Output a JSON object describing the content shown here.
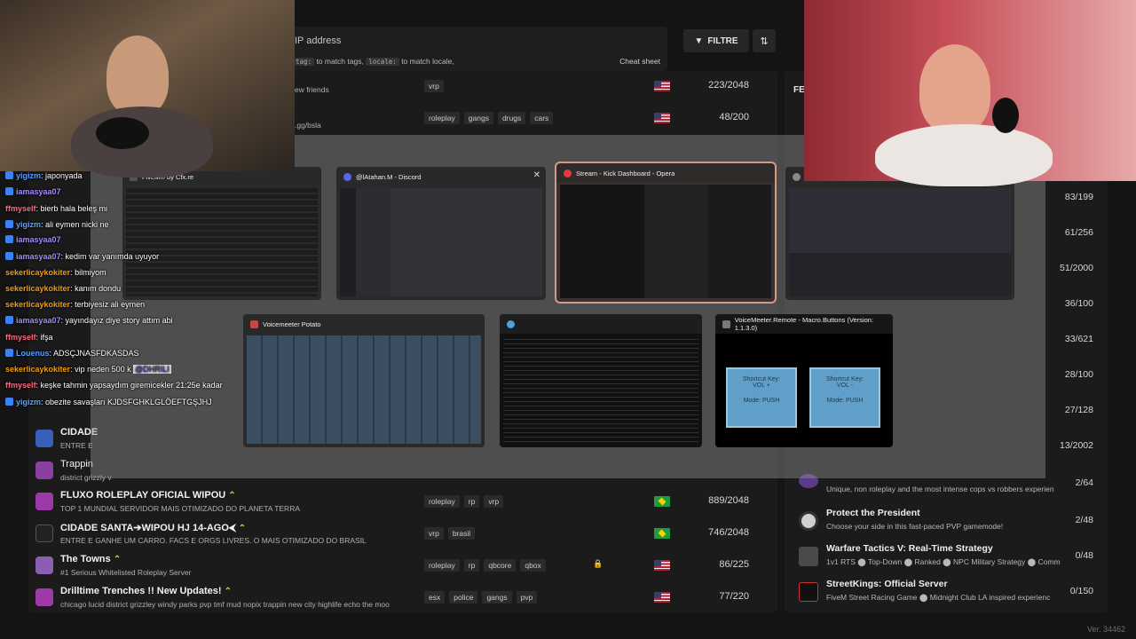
{
  "search": {
    "placeholder": "IP address",
    "hint_tag_code": "tag:",
    "hint_tag_text": "to match tags,",
    "hint_locale_code": "locale:",
    "hint_locale_text": "to match locale,",
    "cheat_sheet": "Cheat sheet"
  },
  "toolbar": {
    "filter_label": "FILTRE",
    "filter_icon": "funnel-icon",
    "sort_icon": "sort-icon"
  },
  "servers": [
    {
      "name": "",
      "desc": "ew friends",
      "tags": [
        "vrp"
      ],
      "flag": "us",
      "count": "223/2048"
    },
    {
      "name": "",
      "desc": ".gg/bsla",
      "tags": [
        "roleplay",
        "gangs",
        "drugs",
        "cars"
      ],
      "flag": "us",
      "count": "48/200"
    },
    {
      "name": "CIDADE",
      "desc": "ENTRE E",
      "tags": [],
      "flag": "",
      "count": ""
    },
    {
      "name": "Trappin",
      "desc": "district grizzly v",
      "tags": [],
      "flag": "",
      "count": ""
    },
    {
      "name": "FLUXO ROLEPLAY OFICIAL WIPOU",
      "desc": "TOP 1 MUNDIAL SERVIDOR MAIS OTIMIZADO DO PLANETA TERRA",
      "tags": [
        "roleplay",
        "rp",
        "vrp"
      ],
      "flag": "br",
      "count": "889/2048"
    },
    {
      "name": "CIDADE SANTA➔WIPOU HJ 14-AGO⮜",
      "desc": "ENTRE E GANHE UM CARRO. FACS E ORGS LIVRES. O MAIS OTIMIZADO DO BRASIL",
      "tags": [
        "vrp",
        "brasil"
      ],
      "flag": "br",
      "count": "746/2048"
    },
    {
      "name": "The Towns",
      "desc": "#1 Serious Whitelisted Roleplay Server",
      "tags": [
        "roleplay",
        "rp",
        "qbcore",
        "qbox"
      ],
      "flag": "us",
      "count": "86/225"
    },
    {
      "name": "Drilltime Trenches !! New Updates!",
      "desc": "chicago lucid district grizzley windy parks pvp tmf mud nopix trappin new city highlife echo the moo",
      "tags": [
        "esx",
        "police",
        "gangs",
        "pvp"
      ],
      "flag": "us",
      "count": "77/220"
    }
  ],
  "right_panel": {
    "heading": "FE",
    "side_counts": [
      "83/199",
      "61/256",
      "51/2000",
      "36/100",
      "33/621",
      "28/100",
      "27/128",
      "13/2002"
    ],
    "items": [
      {
        "name": "",
        "desc": "Unique, non roleplay and the most intense cops vs robbers experien",
        "count": "2/64"
      },
      {
        "name": "Protect the President",
        "desc": "Choose your side in this fast-paced PVP gamemode!",
        "count": "2/48"
      },
      {
        "name": "Warfare Tactics V: Real-Time Strategy",
        "desc": "1v1 RTS ⬤ Top-Down ⬤ Ranked ⬤ NPC Military Strategy ⬤ Comm",
        "count": "0/48"
      },
      {
        "name": "StreetKings: Official Server",
        "desc": "FiveM Street Racing Game ⬤ Midnight Club LA inspired experienc",
        "count": "0/150"
      }
    ]
  },
  "version": "Ver. 34462",
  "task_switcher": {
    "windows": [
      {
        "title": "FiveM® by Cfx.re"
      },
      {
        "title": "@lAtahan.M - Discord"
      },
      {
        "title": "Stream - Kick Dashboard - Opera"
      },
      {
        "title": ""
      },
      {
        "title": "Voicemeeter Potato"
      },
      {
        "title": ""
      },
      {
        "title": "VoiceMeeter.Remote - Macro.Buttons (Version: 1.1.3.0)"
      }
    ],
    "macro_buttons": [
      {
        "line1": "Shortcut Key:",
        "line2": "VOL +",
        "mode": "Mode: PUSH"
      },
      {
        "line1": "Shortcut Key:",
        "line2": "VOL -",
        "mode": "Mode: PUSH"
      }
    ]
  },
  "chat": [
    {
      "user": "yigizm",
      "text": ": japonyada",
      "color": "#5aa0ff",
      "badge": true
    },
    {
      "user": "iamasyaa07",
      "text": "",
      "color": "#a78bfa",
      "badge": true
    },
    {
      "user": "ffmyself",
      "text": ": bierb hala beleş mi",
      "color": "#ff6b81",
      "badge": false
    },
    {
      "user": "yigizm",
      "text": ": ali eymen nicki ne",
      "color": "#5aa0ff",
      "badge": true
    },
    {
      "user": "iamasyaa07",
      "text": "",
      "color": "#a78bfa",
      "badge": true
    },
    {
      "user": "iamasyaa07",
      "text": ": kedim var yanımda uyuyor",
      "color": "#a78bfa",
      "badge": true
    },
    {
      "user": "sekerlicaykokiter",
      "text": ": bilmiyom",
      "color": "#f59e0b",
      "badge": false
    },
    {
      "user": "sekerlicaykokiter",
      "text": ": kanım dondu",
      "color": "#f59e0b",
      "badge": false
    },
    {
      "user": "sekerlicaykokiter",
      "text": ": terbiyesiz ali eymen",
      "color": "#f59e0b",
      "badge": false
    },
    {
      "user": "iamasyaa07",
      "text": ": yayındayız diye story attım abi",
      "color": "#a78bfa",
      "badge": true
    },
    {
      "user": "ffmyself",
      "text": ": ifşa",
      "color": "#ff6b81",
      "badge": false
    },
    {
      "user": "Louenus",
      "text": ": ADSÇJNASFDKASDAS",
      "color": "#5aa0ff",
      "badge": true
    },
    {
      "user": "sekerlicaykokiter",
      "text": ": vip neden 500 k",
      "mention": "@DHRILI",
      "color": "#f59e0b",
      "badge": false
    },
    {
      "user": "ffmyself",
      "text": ": keşke tahmin yapsaydım giremicekler 21:25e kadar",
      "color": "#ff6b81",
      "badge": false
    },
    {
      "user": "yigizm",
      "text": ": obezite savaşları KJDSFGHKLGLÖEFTGŞJHJ",
      "color": "#5aa0ff",
      "badge": true
    }
  ]
}
